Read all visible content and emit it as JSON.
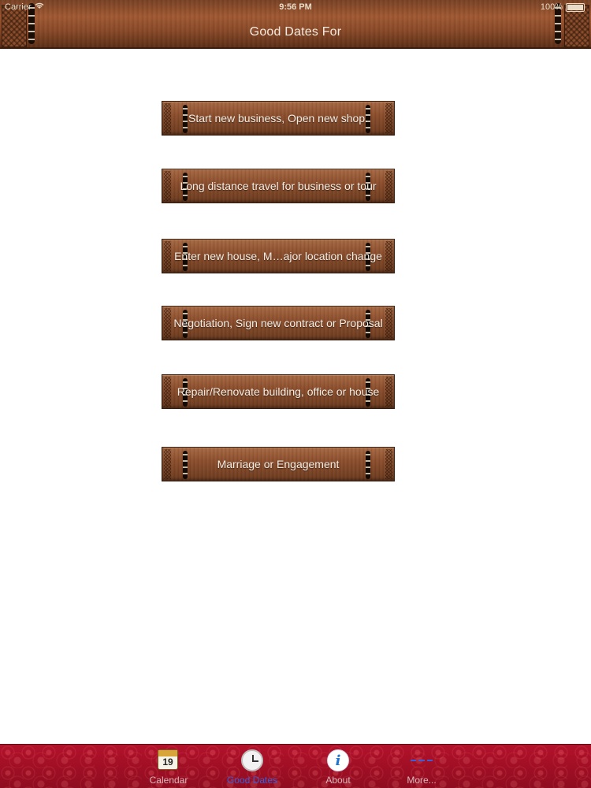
{
  "status_bar": {
    "carrier": "Carrier",
    "time": "9:56 PM",
    "battery": "100%"
  },
  "nav_bar": {
    "title": "Good Dates For"
  },
  "menu": {
    "items": [
      {
        "label": "Start new business, Open new shop."
      },
      {
        "label": "Long distance travel for business or tour"
      },
      {
        "label": "Enter new house, M…ajor location change"
      },
      {
        "label": "Negotiation, Sign new contract or Proposal"
      },
      {
        "label": "Repair/Renovate building, office or house"
      },
      {
        "label": "Marriage or Engagement"
      }
    ]
  },
  "tab_bar": {
    "active": "Good Dates",
    "tabs": [
      {
        "label": "Calendar",
        "icon": "calendar-icon",
        "icon_text": "19"
      },
      {
        "label": "Good Dates",
        "icon": "clock-icon"
      },
      {
        "label": "About",
        "icon": "info-icon",
        "icon_text": "i"
      },
      {
        "label": "More...",
        "icon": "more-icon"
      }
    ]
  },
  "colors": {
    "wood": "#8d4f2d",
    "tab_bar_red": "#a3102a",
    "active_tab": "#3b5fd9"
  }
}
